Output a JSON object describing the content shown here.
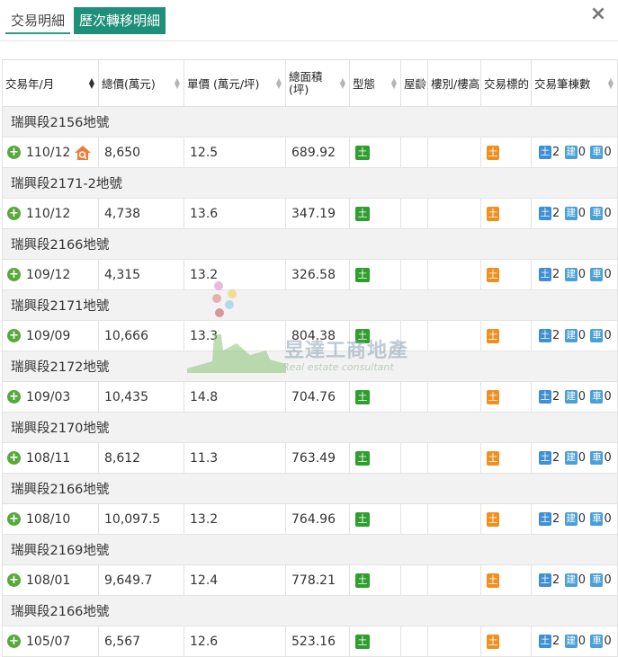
{
  "tabs": [
    {
      "label": "交易明細",
      "active": false
    },
    {
      "label": "歷次轉移明細",
      "active": true
    }
  ],
  "close_icon": "×",
  "columns": [
    {
      "label": "交易年/月",
      "sort": "active"
    },
    {
      "label": "總價(萬元)",
      "sort": "both"
    },
    {
      "label": "單價 (萬元/坪)",
      "sort": "both"
    },
    {
      "label_line1": "總面積",
      "label_line2": "(坪)",
      "sort": "both"
    },
    {
      "label": "型態",
      "sort": "both"
    },
    {
      "label": "屋齡",
      "sort": "both"
    },
    {
      "label": "樓別/樓高",
      "sort": "none"
    },
    {
      "label": "交易標的",
      "sort": "none"
    },
    {
      "label": "交易筆棟數",
      "sort": "both"
    }
  ],
  "rows": [
    {
      "group": "瑞興段2156地號",
      "date": "110/12",
      "total": "8,650",
      "unit": "12.5",
      "area": "689.92",
      "type": "土",
      "target": "土",
      "land": "土",
      "land_n": "2",
      "build": "建",
      "build_n": "0",
      "car": "車",
      "car_n": "0",
      "search_icon": true
    },
    {
      "group": "瑞興段2171-2地號",
      "date": "110/12",
      "total": "4,738",
      "unit": "13.6",
      "area": "347.19",
      "type": "土",
      "target": "土",
      "land": "土",
      "land_n": "2",
      "build": "建",
      "build_n": "0",
      "car": "車",
      "car_n": "0"
    },
    {
      "group": "瑞興段2166地號",
      "date": "109/12",
      "total": "4,315",
      "unit": "13.2",
      "area": "326.58",
      "type": "土",
      "target": "土",
      "land": "土",
      "land_n": "2",
      "build": "建",
      "build_n": "0",
      "car": "車",
      "car_n": "0"
    },
    {
      "group": "瑞興段2171地號",
      "date": "109/09",
      "total": "10,666",
      "unit": "13.3",
      "area": "804.38",
      "type": "土",
      "target": "土",
      "land": "土",
      "land_n": "2",
      "build": "建",
      "build_n": "0",
      "car": "車",
      "car_n": "0"
    },
    {
      "group": "瑞興段2172地號",
      "date": "109/03",
      "total": "10,435",
      "unit": "14.8",
      "area": "704.76",
      "type": "土",
      "target": "土",
      "land": "土",
      "land_n": "2",
      "build": "建",
      "build_n": "0",
      "car": "車",
      "car_n": "0"
    },
    {
      "group": "瑞興段2170地號",
      "date": "108/11",
      "total": "8,612",
      "unit": "11.3",
      "area": "763.49",
      "type": "土",
      "target": "土",
      "land": "土",
      "land_n": "2",
      "build": "建",
      "build_n": "0",
      "car": "車",
      "car_n": "0"
    },
    {
      "group": "瑞興段2166地號",
      "date": "108/10",
      "total": "10,097.5",
      "unit": "13.2",
      "area": "764.96",
      "type": "土",
      "target": "土",
      "land": "土",
      "land_n": "2",
      "build": "建",
      "build_n": "0",
      "car": "車",
      "car_n": "0"
    },
    {
      "group": "瑞興段2169地號",
      "date": "108/01",
      "total": "9,649.7",
      "unit": "12.4",
      "area": "778.21",
      "type": "土",
      "target": "土",
      "land": "土",
      "land_n": "2",
      "build": "建",
      "build_n": "0",
      "car": "車",
      "car_n": "0"
    },
    {
      "group": "瑞興段2166地號",
      "date": "105/07",
      "total": "6,567",
      "unit": "12.6",
      "area": "523.16",
      "type": "土",
      "target": "土",
      "land": "土",
      "land_n": "2",
      "build": "建",
      "build_n": "0",
      "car": "車",
      "car_n": "0"
    }
  ],
  "watermark": {
    "title": "昱達工商地產",
    "subtitle": "Real estate consultant"
  },
  "colors": {
    "tab_active": "#1e8f79",
    "type_badge": "#2f9e2f",
    "target_badge": "#f08f1f",
    "mini_badge": "#3f8fd7",
    "plus": "#58a93c"
  }
}
